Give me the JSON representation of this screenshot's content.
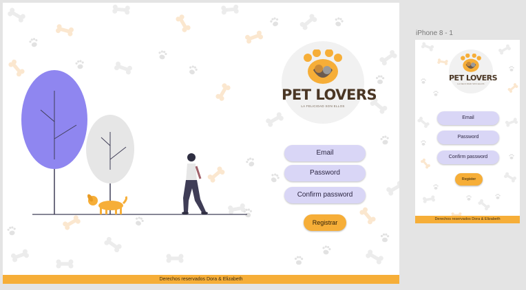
{
  "artboards": {
    "mobile_label": "iPhone 8 - 1"
  },
  "brand": {
    "name": "PET LOVERS",
    "tagline": "LA FELICIDAD SON ELLOS"
  },
  "form": {
    "email_label": "Email",
    "password_label": "Password",
    "confirm_password_label": "Confirm password",
    "submit_label_desktop": "Registrar",
    "submit_label_mobile": "Register"
  },
  "footer": {
    "text": "Derechos reservados Dora & Elizabeth"
  },
  "colors": {
    "accent": "#f6ae38",
    "field_bg": "#d9d6f6",
    "tree_purple": "#8f86f0",
    "tree_gray": "#e6e6e6",
    "brand_brown": "#4a3624"
  },
  "icons": [
    "bone-icon",
    "paw-icon",
    "dog-icon",
    "person-icon",
    "tree-icon"
  ]
}
